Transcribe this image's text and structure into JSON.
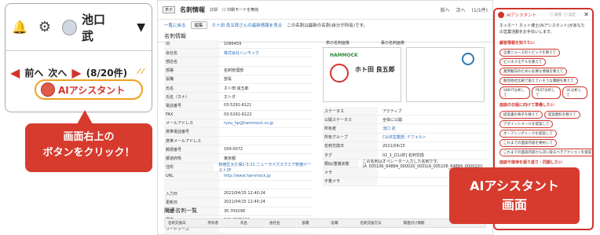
{
  "main": {
    "badge": "表示",
    "title": "名刺情報",
    "title_sub": "詳細",
    "checkbox": "印刷モードを無効",
    "nav": {
      "prev": "前へ",
      "next": "次へ",
      "count": "(1/1件)"
    },
    "sub": {
      "back": "一覧に戻る",
      "edit": "編集",
      "link_text": "ホト田 良五郎さんの最新情報を見る",
      "info": "この名刺は最新の名刺(自分が所有)です。"
    },
    "section": "名刺情報",
    "fields": [
      {
        "k": "ID",
        "v": "1086459"
      },
      {
        "k": "会社名",
        "v": "株式会社ハンモック",
        "link": true
      },
      {
        "k": "部店名",
        "v": ""
      },
      {
        "k": "部署",
        "v": "名刺管理部"
      },
      {
        "k": "役職",
        "v": "部長"
      },
      {
        "k": "氏名",
        "v": "ホト田 良五郎"
      },
      {
        "k": "氏名（カナ）",
        "v": "ホトダ"
      },
      {
        "k": "電話番号",
        "v": "03-5291-6121"
      },
      {
        "k": "FAX",
        "v": "03-5291-6122"
      },
      {
        "k": "メールアドレス",
        "v": "ryou_hp@hammock.co.jp",
        "link": true
      },
      {
        "k": "携帯電話番号",
        "v": ""
      },
      {
        "k": "携帯メールアドレス",
        "v": ""
      },
      {
        "k": "郵便番号",
        "v": "169-0072"
      },
      {
        "k": "都道府県",
        "v": "東京都"
      },
      {
        "k": "住所",
        "v": "新宿区大久保1-3-21 ニューライズスクエア新宿イースト3F",
        "link": true
      },
      {
        "k": "URL",
        "v": "http://www.hammock.jp",
        "link": true
      },
      {
        "k": "",
        "v": ""
      },
      {
        "k": "入力日",
        "v": "2021/04/15 12:40:24"
      },
      {
        "k": "更新日",
        "v": "2021/04/15 12:40:24"
      },
      {
        "k": "緯度",
        "v": "35.700298"
      },
      {
        "k": "経度",
        "v": "139.7075161"
      },
      {
        "k": "リードソース",
        "v": ""
      }
    ],
    "card_front": "表の名刺画像",
    "card_back": "裏の名刺画像",
    "card_name": "ホト田 良五郎",
    "card_company": "HAMMOCK",
    "status": [
      {
        "k": "ステータス",
        "v": "アクティブ"
      },
      {
        "k": "公開ステータス",
        "v": "全体に公開"
      },
      {
        "k": "所有者",
        "v": "池口 武",
        "link": true
      },
      {
        "k": "所有グループ",
        "v": "CLUE営業部, デフォルト",
        "link": true
      },
      {
        "k": "名刺交換日",
        "v": "2021/04/15"
      },
      {
        "k": "タグ",
        "v": "02_1_[CLUE] 名刺交換"
      },
      {
        "k": "類似/重複状態",
        "v": "この名刺はオペレーター入力した名刺です。 (A_005106_64884_000020_0001(A_005106_64884_000020))"
      },
      {
        "k": "メモ",
        "v": ""
      },
      {
        "k": "不着メモ",
        "v": ""
      }
    ],
    "related": "関連名刺一覧",
    "table_cols": [
      "名刺交換日",
      "所有者",
      "氏名",
      "会社名",
      "部署",
      "役職",
      "名刺交換方法",
      "関連付け期間"
    ]
  },
  "panel": {
    "title": "AIアシスタント",
    "history": "〇 履歴",
    "settings": "〇 設定",
    "greet": "ホッホー！ホット博士(AIアシスタント)があなたの営業活動をお手伝いします。",
    "sec1": "顧客情報を知りたい",
    "chips1": [
      "企業ニュースのトピックを教えて",
      "ビジネスモデルを教えて",
      "業界動向のために必要な情報を教えて",
      "競合他社比較で抱えていそうな課題を教えて"
    ],
    "chiprow1": [
      "SWOT分析して",
      "PEST分析して",
      "3C分析して"
    ],
    "sec2": "面談の日程に向けて準備したい",
    "chiprow2": [
      "提案書の骨子を教えて",
      "提案資料を教えて"
    ],
    "chips2": [
      "アポイントメールを提案して",
      "オープニングトークを提案して",
      "これまでの面談内容を要約して",
      "これまでの面談内容から次に取るべきアクションを提案して"
    ],
    "sec3": "面談や接待を振り返り・同期したい",
    "chips3": [
      "面談に同行した議事録要約して"
    ],
    "label": "AIアシスタント\n画面"
  },
  "zoom": {
    "user": "池口　武",
    "prev": "前へ",
    "next": "次へ",
    "count": "(8/20件)",
    "ai": "AIアシスタント",
    "bubble": "画面右上の\nボタンをクリック！"
  },
  "colors": {
    "accent": "#d73b2e",
    "orange": "#f0a020",
    "link": "#2a6fb5"
  }
}
